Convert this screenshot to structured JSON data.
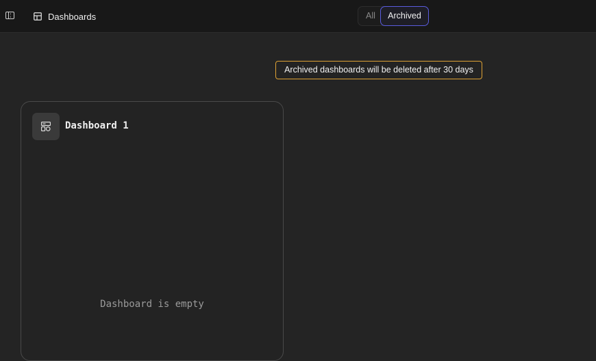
{
  "topbar": {
    "sidebar_toggle_icon": "sidebar-toggle-icon",
    "breadcrumb": {
      "icon": "dashboard-layout-icon",
      "label": "Dashboards"
    },
    "tabs": [
      {
        "label": "All",
        "selected": false
      },
      {
        "label": "Archived",
        "selected": true
      }
    ]
  },
  "notice": {
    "text": "Archived dashboards will be deleted after 30 days",
    "border_color": "#e0a335"
  },
  "dashboards": [
    {
      "title": "Dashboard 1",
      "icon": "dashboard-widgets-icon",
      "empty_text": "Dashboard is empty"
    }
  ],
  "colors": {
    "accent": "#5a5ce0",
    "background": "#242424",
    "topbar": "#181818"
  }
}
